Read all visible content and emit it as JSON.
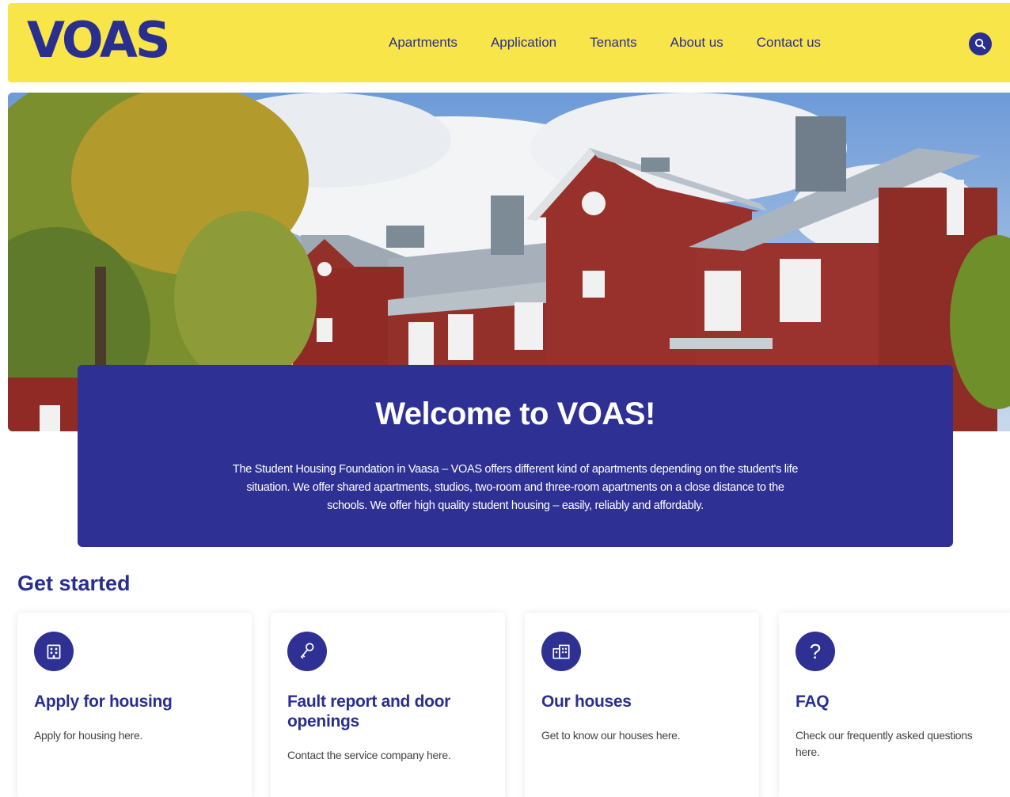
{
  "header": {
    "logo": "VOAS",
    "nav": [
      "Apartments",
      "Application",
      "Tenants",
      "About us",
      "Contact us"
    ]
  },
  "hero": {
    "title": "Welcome to VOAS!",
    "text": "The Student Housing Foundation in Vaasa – VOAS offers different kind of apartments depending on the student's life situation. We offer shared apartments, studios, two-room and three-room apartments on a close distance to the schools. We offer high quality student housing – easily, reliably and affordably."
  },
  "get_started": {
    "title": "Get started",
    "cards": [
      {
        "title": "Apply for housing",
        "desc": "Apply for housing here.",
        "icon": "building-icon"
      },
      {
        "title": "Fault report and door openings",
        "desc": "Contact the service company here.",
        "icon": "key-icon"
      },
      {
        "title": "Our houses",
        "desc": "Get to know our houses here.",
        "icon": "houses-icon"
      },
      {
        "title": "FAQ",
        "desc": "Check our frequently asked questions here.",
        "icon": "question-icon"
      }
    ]
  },
  "colors": {
    "brand_blue": "#2e3193",
    "brand_yellow": "#f8e54a"
  }
}
